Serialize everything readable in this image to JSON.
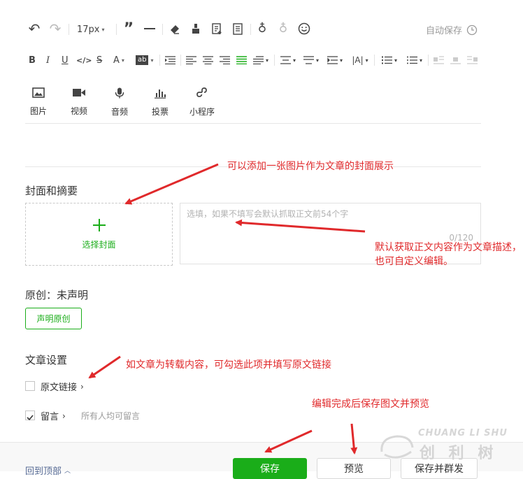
{
  "toolbar": {
    "font_size": "17px",
    "autosave_label": "自动保存",
    "format_buttons": {
      "bold": "B",
      "italic": "I",
      "underline": "U",
      "code": "</>",
      "strike": "S",
      "font_color": "A",
      "bg_color": "ab"
    }
  },
  "media": [
    {
      "label": "图片"
    },
    {
      "label": "视频"
    },
    {
      "label": "音频"
    },
    {
      "label": "投票"
    },
    {
      "label": "小程序"
    }
  ],
  "cover": {
    "section_title": "封面和摘要",
    "choose_label": "选择封面",
    "abstract_placeholder": "选填，如果不填写会默认抓取正文前54个字",
    "abstract_counter": "0/120"
  },
  "original": {
    "status_text": "原创：未声明",
    "declare_button": "声明原创"
  },
  "settings": {
    "section_title": "文章设置",
    "source_link_label": "原文链接",
    "source_link_checked": false,
    "comment_label": "留言",
    "comment_checked": true,
    "comment_hint": "所有人均可留言"
  },
  "bottom": {
    "back_to_top": "回到顶部",
    "save_button": "保存",
    "preview_button": "预览",
    "send_button": "保存并群发"
  },
  "annotations": {
    "cover_note": "可以添加一张图片作为文章的封面展示",
    "abstract_note": "默认获取正文内容作为文章描述，也可自定义编辑。",
    "source_note": "如文章为转载内容，可勾选此项并填写原文链接",
    "save_note": "编辑完成后保存图文并预览"
  },
  "watermark": {
    "text_en": "CHUANG LI SHU",
    "text_cn": "创 利 树"
  },
  "colors": {
    "green": "#1aad19",
    "annotation_red": "#e0292b"
  }
}
